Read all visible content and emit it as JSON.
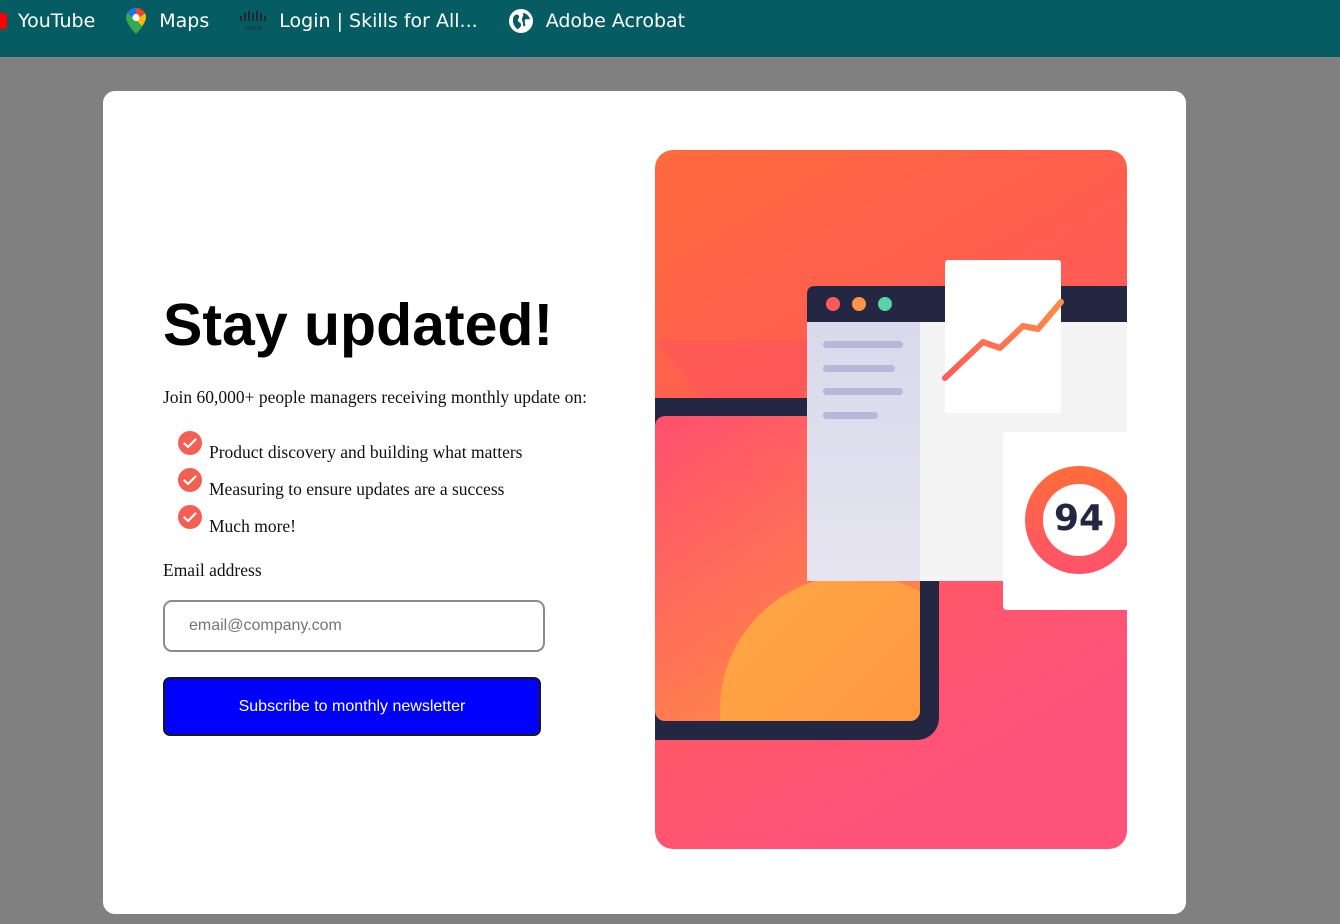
{
  "bookmarks": [
    {
      "label": "YouTube",
      "icon": "youtube-icon"
    },
    {
      "label": "Maps",
      "icon": "maps-pin-icon"
    },
    {
      "label": "Login | Skills for All...",
      "icon": "cisco-icon"
    },
    {
      "label": "Adobe Acrobat",
      "icon": "globe-icon"
    }
  ],
  "signup": {
    "title": "Stay updated!",
    "intro": "Join 60,000+ people managers receiving monthly update on:",
    "features": [
      "Product discovery and building what matters",
      "Measuring to ensure updates are a success",
      "Much more!"
    ],
    "email_label": "Email address",
    "email_placeholder": "email@company.com",
    "email_value": "",
    "subscribe_label": "Subscribe to monthly newsletter"
  },
  "illustration": {
    "score": "94"
  },
  "colors": {
    "bookmark_bar": "#065c63",
    "backdrop": "#808080",
    "accent_check": "#f35f52",
    "button": "#0000ff",
    "gradient_start": "#ff6a3d",
    "gradient_end": "#ff527b",
    "navy": "#242742"
  }
}
